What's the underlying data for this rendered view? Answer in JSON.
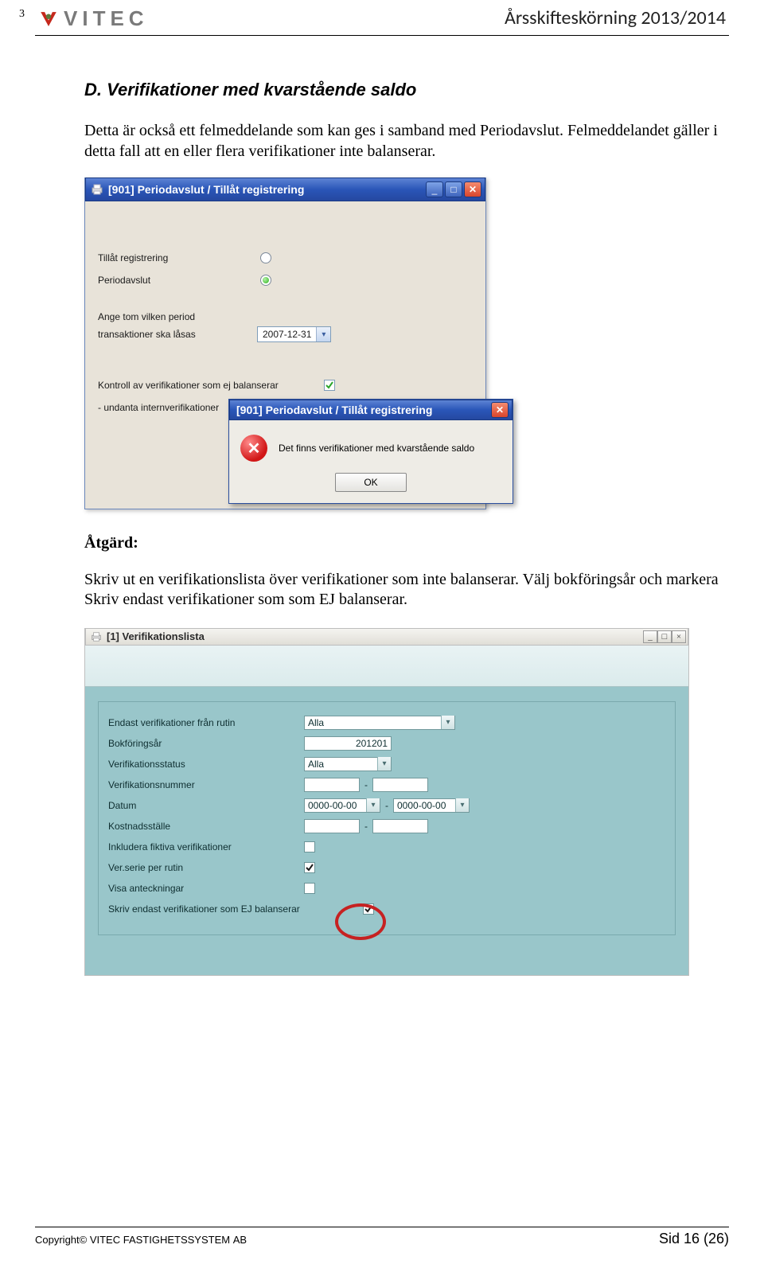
{
  "header": {
    "page_small": "3",
    "brand_text": "VITEC",
    "doc_title": "Årsskifteskörning 2013/2014"
  },
  "section": {
    "heading": "D.  Verifikationer med kvarstående saldo",
    "para1": "Detta är också ett felmeddelande som kan ges i samband med Periodavslut. Felmeddelandet gäller i detta fall att en eller flera verifikationer inte balanserar.",
    "action_label": "Åtgärd:",
    "para2": "Skriv ut en verifikationslista över verifikationer som inte balanserar. Välj bokföringsår och markera Skriv endast verifikationer som som EJ balanserar."
  },
  "win1": {
    "title": "[901]   Periodavslut / Tillåt registrering",
    "labels": {
      "allow_reg": "Tillåt registrering",
      "period_close": "Periodavslut",
      "lock_period_a": "Ange tom vilken period",
      "lock_period_b": "transaktioner ska låsas",
      "check_balance": "Kontroll av verifikationer som ej balanserar",
      "exclude_internal": "- undanta internverifikationer"
    },
    "date_value": "2007-12-31",
    "modal": {
      "title": "[901]  Periodavslut / Tillåt registrering",
      "message": "Det finns verifikationer med kvarstående saldo",
      "ok": "OK"
    }
  },
  "win2": {
    "title": "[1]  Verifikationslista",
    "labels": {
      "only_from_routine": "Endast verifikationer från rutin",
      "fiscal_year": "Bokföringsår",
      "status": "Verifikationsstatus",
      "ver_no": "Verifikationsnummer",
      "date": "Datum",
      "cost_center": "Kostnadsställe",
      "include_fictive": "Inkludera fiktiva verifikationer",
      "series_per_routine": "Ver.serie per rutin",
      "show_notes": "Visa anteckningar",
      "only_unbalanced": "Skriv endast verifikationer som EJ balanserar"
    },
    "values": {
      "routine": "Alla",
      "fiscal_year": "201201",
      "status": "Alla",
      "date_from": "0000-00-00",
      "date_to": "0000-00-00"
    }
  },
  "footer": {
    "left_a": "Copyright© V",
    "left_b": "ITEC FASTIGHETSSYSTEM ",
    "left_c": "AB",
    "right": "Sid 16 (26)"
  }
}
